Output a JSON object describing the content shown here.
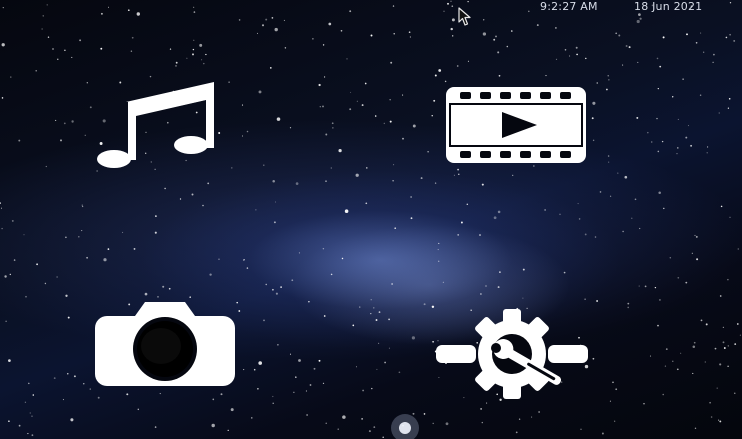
{
  "topbar": {
    "time": "9:2:27 AM",
    "date": "18 Jun 2021"
  },
  "launchers": [
    {
      "id": "music",
      "icon": "music-note-icon"
    },
    {
      "id": "video",
      "icon": "film-play-icon"
    },
    {
      "id": "camera",
      "icon": "camera-icon"
    },
    {
      "id": "settings",
      "icon": "gear-wrench-icon"
    }
  ],
  "theme": {
    "icon_color": "#ffffff",
    "text_color": "#d8dde8",
    "background": "#05070f"
  }
}
